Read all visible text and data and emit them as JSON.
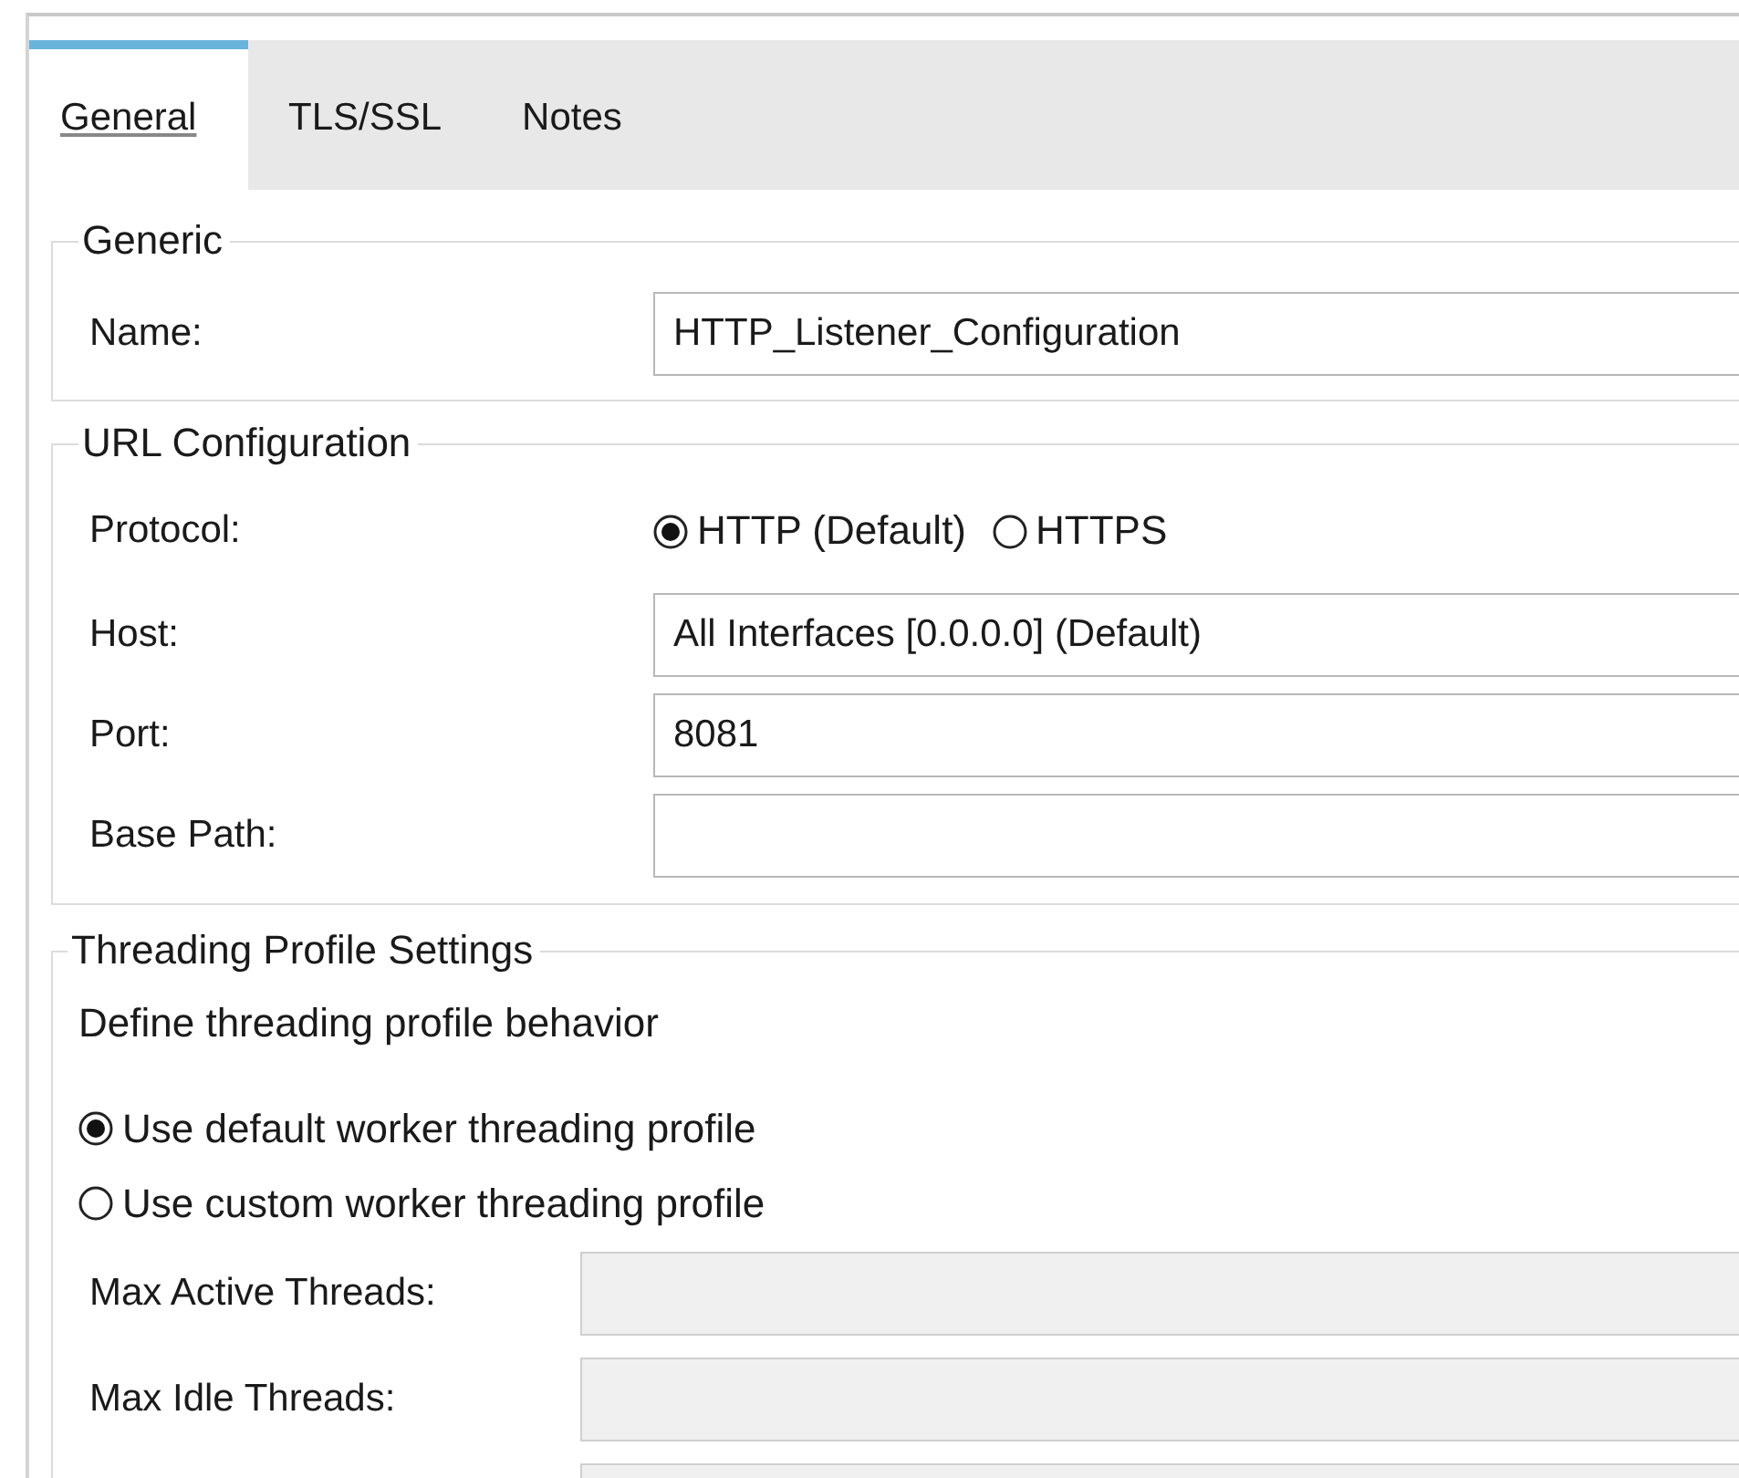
{
  "tabs": [
    {
      "label": "General",
      "selected": true
    },
    {
      "label": "TLS/SSL",
      "selected": false
    },
    {
      "label": "Notes",
      "selected": false
    }
  ],
  "generic": {
    "title": "Generic",
    "name_label": "Name:",
    "name_value": "HTTP_Listener_Configuration"
  },
  "url_configuration": {
    "title": "URL Configuration",
    "protocol_label": "Protocol:",
    "protocols": [
      {
        "label": "HTTP (Default)",
        "selected": true
      },
      {
        "label": "HTTPS",
        "selected": false
      }
    ],
    "fields": [
      {
        "label": "Host:",
        "value": "All Interfaces [0.0.0.0] (Default)"
      },
      {
        "label": "Port:",
        "value": "8081"
      },
      {
        "label": "Base Path:"
      }
    ]
  },
  "threading_profile": {
    "title": "Threading Profile Settings",
    "description": "Define threading profile behavior",
    "options": [
      {
        "label": "Use default worker threading profile",
        "selected": true
      },
      {
        "label": "Use custom worker threading profile",
        "selected": false
      }
    ],
    "fields": [
      {
        "label": "Max Active Threads:",
        "disabled": true
      },
      {
        "label": "Max Idle Threads:",
        "disabled": true
      },
      {
        "disabled": true
      }
    ]
  }
}
